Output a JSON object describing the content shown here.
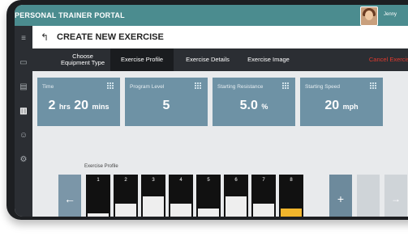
{
  "app": {
    "title": "PERSONAL TRAINER PORTAL",
    "user": "Jenny"
  },
  "sidebar": {
    "icons": [
      "menu-icon",
      "calendar-icon",
      "list-icon",
      "library-icon",
      "users-icon",
      "gear-icon"
    ],
    "active": "library-icon"
  },
  "header": {
    "title": "CREATE NEW EXERCISE"
  },
  "tabs": [
    {
      "label": "Choose\nEquipment Type"
    },
    {
      "label": "Exercise Profile"
    },
    {
      "label": "Exercise Details"
    },
    {
      "label": "Exercise Image"
    },
    {
      "label": "Cancel Exercise"
    }
  ],
  "cards": [
    {
      "label": "Time",
      "value_html": "2 hrs 20 mins"
    },
    {
      "label": "Program Level",
      "value": "5"
    },
    {
      "label": "Starting Resistance",
      "value": "5.0",
      "unit": "%"
    },
    {
      "label": "Starting Speed",
      "value": "20",
      "unit": "mph"
    }
  ],
  "time_parts": {
    "hours": "2",
    "hours_unit": "hrs",
    "minutes": "20",
    "minutes_unit": "mins"
  },
  "profile": {
    "label": "Exercise Profile",
    "segments": [
      {
        "num": "1",
        "level": 0.17
      },
      {
        "num": "2",
        "level": 0.4
      },
      {
        "num": "3",
        "level": 0.55
      },
      {
        "num": "4",
        "level": 0.4
      },
      {
        "num": "5",
        "level": 0.28
      },
      {
        "num": "6",
        "level": 0.55
      },
      {
        "num": "7",
        "level": 0.4
      },
      {
        "num": "8",
        "level": 0.28
      }
    ],
    "selected": "8"
  },
  "colors": {
    "topbar": "#4b8c8f",
    "card": "#6e92a5",
    "selected": "#f1b52c",
    "cancel": "#e03a2f"
  }
}
